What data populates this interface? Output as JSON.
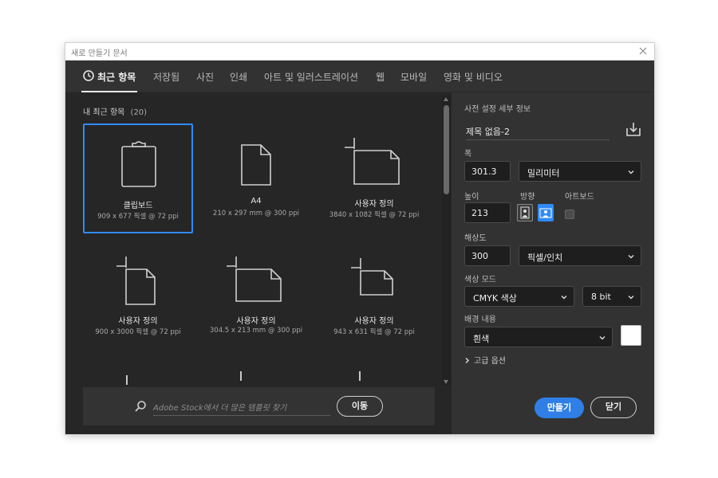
{
  "dialog": {
    "title": "새로 만들기 문서",
    "close_icon": "close-icon"
  },
  "tabs": [
    {
      "label": "최근 항목",
      "active": true
    },
    {
      "label": "저장됨",
      "active": false
    },
    {
      "label": "사진",
      "active": false
    },
    {
      "label": "인쇄",
      "active": false
    },
    {
      "label": "아트 및 일러스트레이션",
      "active": false
    },
    {
      "label": "웹",
      "active": false
    },
    {
      "label": "모바일",
      "active": false
    },
    {
      "label": "영화 및 비디오",
      "active": false
    }
  ],
  "recent": {
    "heading": "내 최근 항목",
    "count": "(20)",
    "presets": [
      {
        "name": "클립보드",
        "dims": "909 x 677 픽셀 @ 72 ppi",
        "icon": "clipboard-icon",
        "selected": true
      },
      {
        "name": "A4",
        "dims": "210 x 297 mm @ 300 ppi",
        "icon": "document-icon",
        "selected": false
      },
      {
        "name": "사용자 정의",
        "dims": "3840 x 1082 픽셀 @ 72 ppi",
        "icon": "custom-document-icon",
        "selected": false
      },
      {
        "name": "사용자 정의",
        "dims": "900 x 3000 픽셀 @ 72 ppi",
        "icon": "custom-document-icon",
        "selected": false
      },
      {
        "name": "사용자 정의",
        "dims": "304.5 x 213 mm @ 300 ppi",
        "icon": "custom-document-icon",
        "selected": false
      },
      {
        "name": "사용자 정의",
        "dims": "943 x 631 픽셀 @ 72 ppi",
        "icon": "custom-document-icon",
        "selected": false
      }
    ]
  },
  "search": {
    "placeholder_brand": "Adobe Stock",
    "placeholder_rest": "에서 더 많은 템플릿 찾기",
    "go_label": "이동"
  },
  "details": {
    "heading": "사전 설정 세부 정보",
    "doc_name": "제목 없음-2",
    "width_label": "폭",
    "width_value": "301.3",
    "width_unit": "밀리미터",
    "height_label": "높이",
    "height_value": "213",
    "orientation_label": "방향",
    "artboard_label": "아트보드",
    "artboard_checked": false,
    "orientation": "landscape",
    "resolution_label": "해상도",
    "resolution_value": "300",
    "resolution_unit": "픽셀/인치",
    "color_mode_label": "색상 모드",
    "color_mode_value": "CMYK 색상",
    "bit_depth": "8 bit",
    "background_label": "배경 내용",
    "background_value": "흰색",
    "background_color": "#ffffff",
    "advanced_label": "고급 옵션",
    "create_label": "만들기",
    "close_label": "닫기"
  },
  "colors": {
    "accent": "#2f8bf5",
    "panel": "#323232",
    "grid_bg": "#262626"
  }
}
